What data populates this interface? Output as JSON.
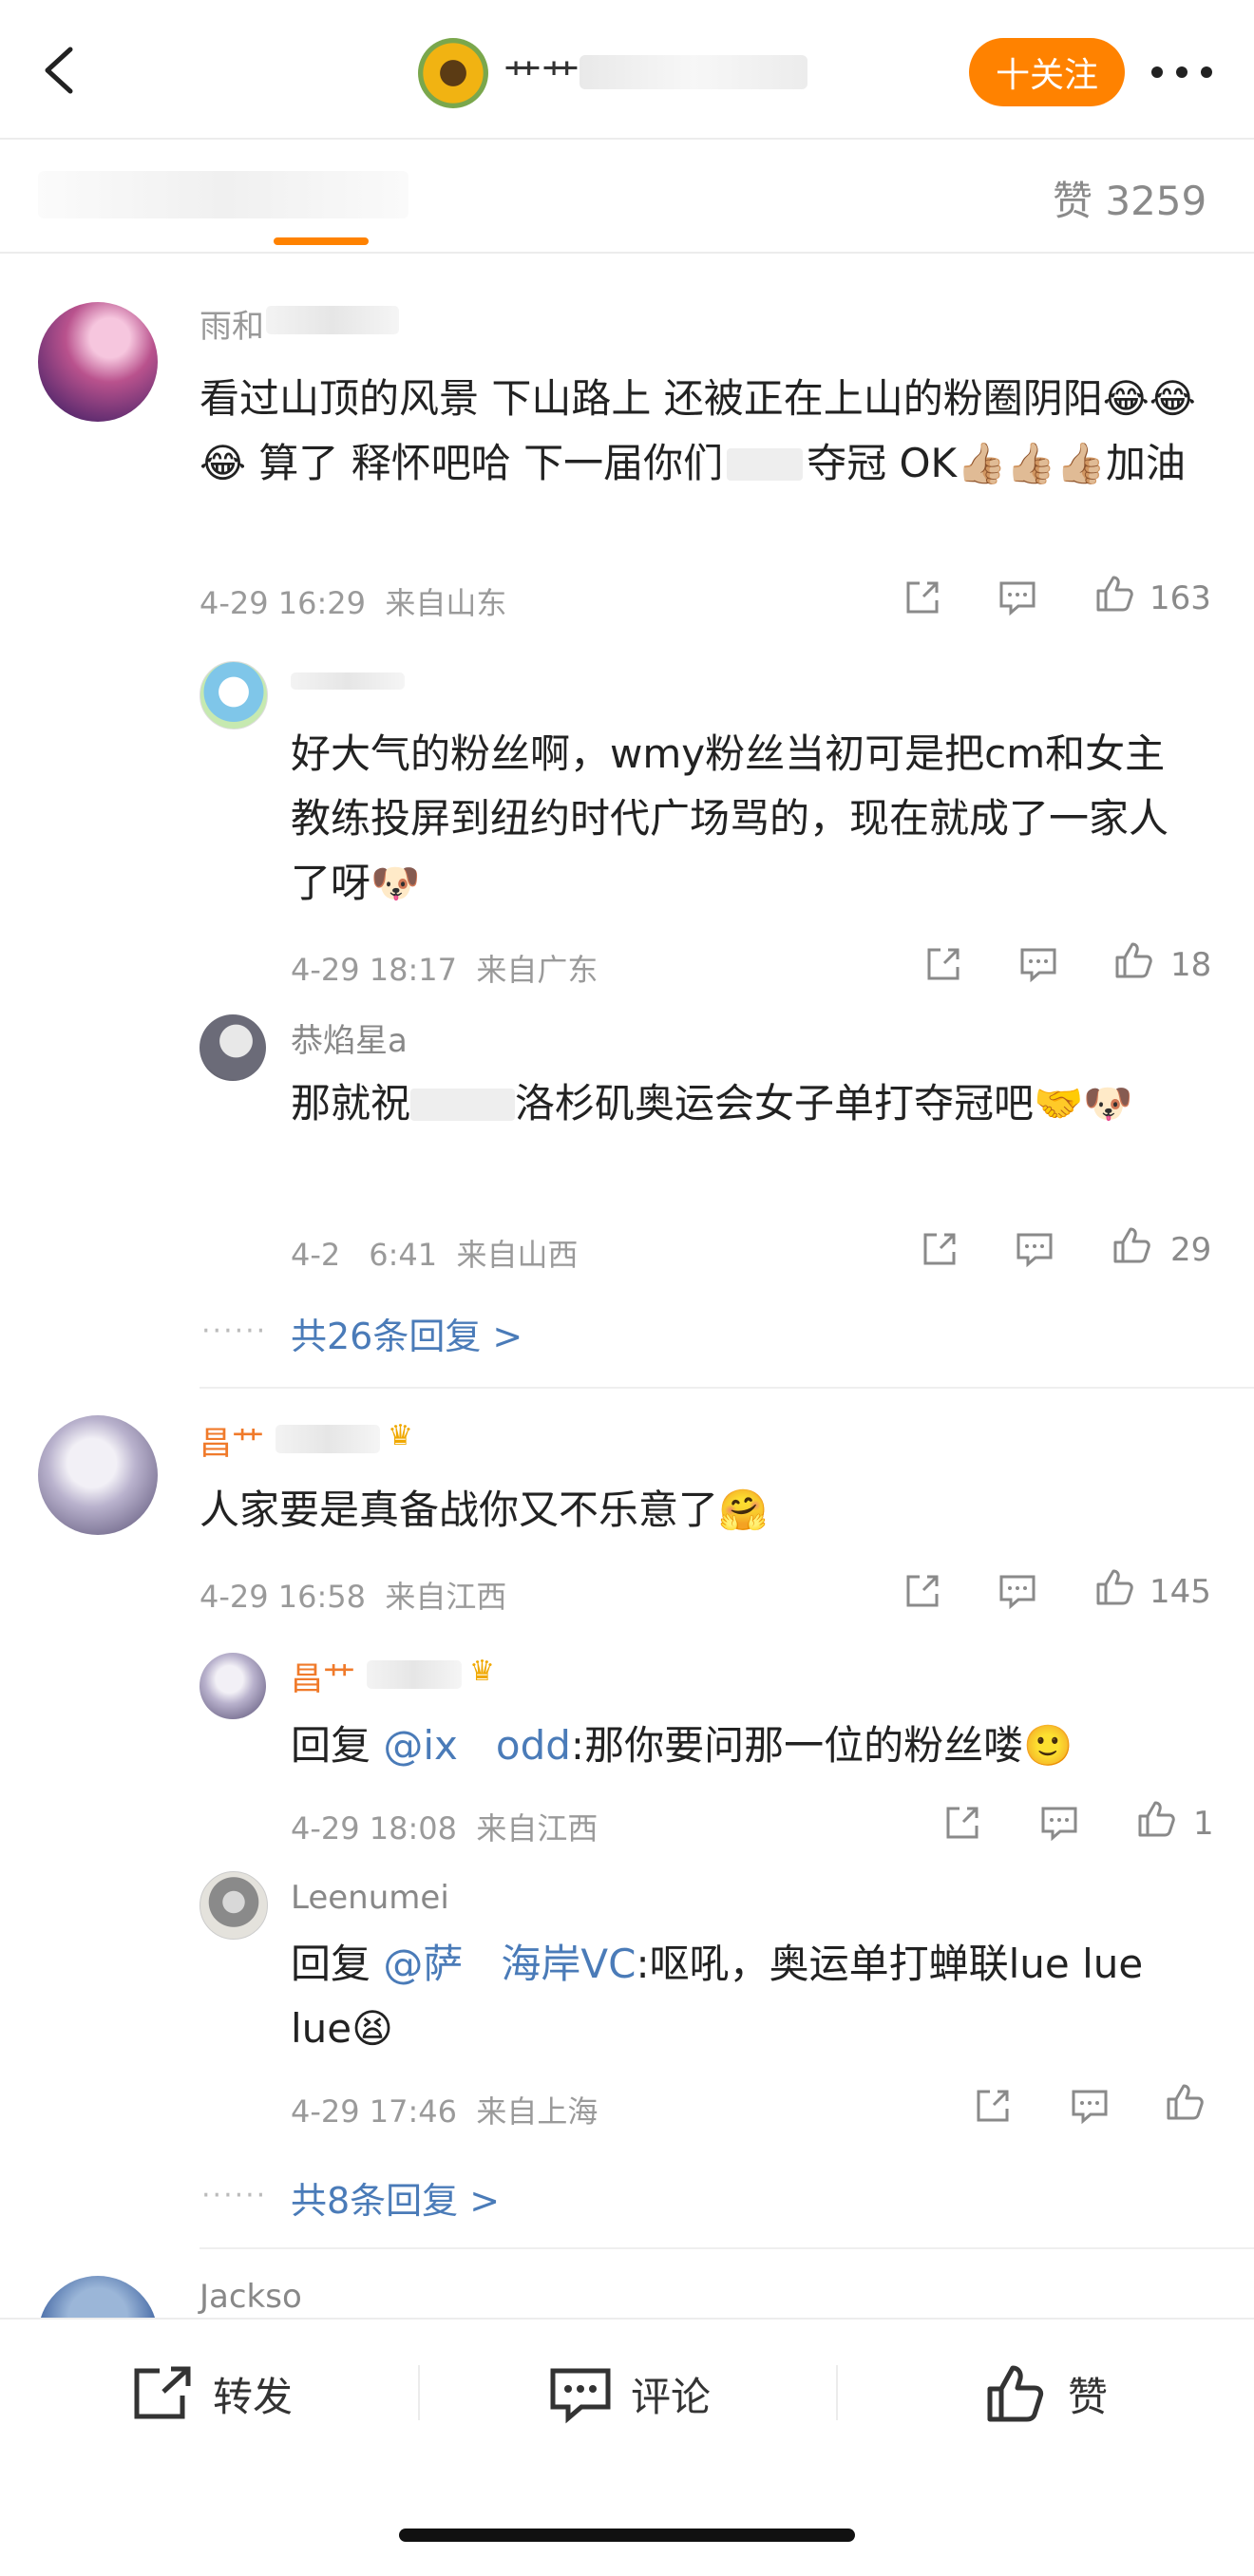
{
  "header": {
    "nickname_partial": "艹艹",
    "follow_label": "十关注"
  },
  "tabs": {
    "likes_label": "赞 3259"
  },
  "comments": [
    {
      "name": "雨和",
      "text": "看过山顶的风景 下山路上 还被正在上山的粉圈阴阳😂😂😂 算了 释怀吧哈 下一届你们",
      "text_tail": "夺冠 OK👍🏼👍🏼👍🏼加油",
      "time": "4-29 16:29",
      "location": "来自山东",
      "likes": "163",
      "replies": [
        {
          "name": "",
          "text": "好大气的粉丝啊，wmy粉丝当初可是把cm和女主教练投屏到纽约时代广场骂的，现在就成了一家人了呀🐶",
          "time": "4-29 18:17",
          "location": "来自广东",
          "likes": "18"
        },
        {
          "name": "恭焰星a",
          "text": "那就祝",
          "text_tail": "洛杉矶奥运会女子单打夺冠吧🤝🐶",
          "time": "4-2",
          "time_tail": "6:41",
          "location": "来自山西",
          "likes": "29"
        }
      ],
      "more_replies": "共26条回复 >"
    },
    {
      "name": "昌艹",
      "text": "人家要是真备战你又不乐意了🤗",
      "time": "4-29 16:58",
      "location": "来自江西",
      "likes": "145",
      "replies": [
        {
          "name": "昌艹",
          "reply_prefix": "回复 ",
          "mention": "@ix",
          "mention_tail": "odd",
          "text": ":那你要问那一位的粉丝喽🙂",
          "time": "4-29 18:08",
          "location": "来自江西",
          "likes": "1"
        },
        {
          "name": "Leenumei",
          "reply_prefix": "回复 ",
          "mention": "@萨",
          "mention_tail": "海岸VC",
          "text": ":呕吼，奥运单打蝉联lue lue lue😫",
          "time": "4-29 17:46",
          "location": "来自上海",
          "likes": ""
        }
      ],
      "more_replies": "共8条回复 >"
    },
    {
      "name": "Jackso"
    }
  ],
  "dots": "······",
  "bottom_bar": {
    "repost_label": "转发",
    "comment_label": "评论",
    "like_label": "赞"
  },
  "icons": {
    "back": "back-arrow-icon",
    "more": "more-dots-icon",
    "repost": "repost-icon",
    "comment": "comment-icon",
    "like": "thumb-up-icon"
  },
  "colors": {
    "accent": "#ff8200",
    "link": "#4a7bb8",
    "meta": "#9a9a9a"
  }
}
